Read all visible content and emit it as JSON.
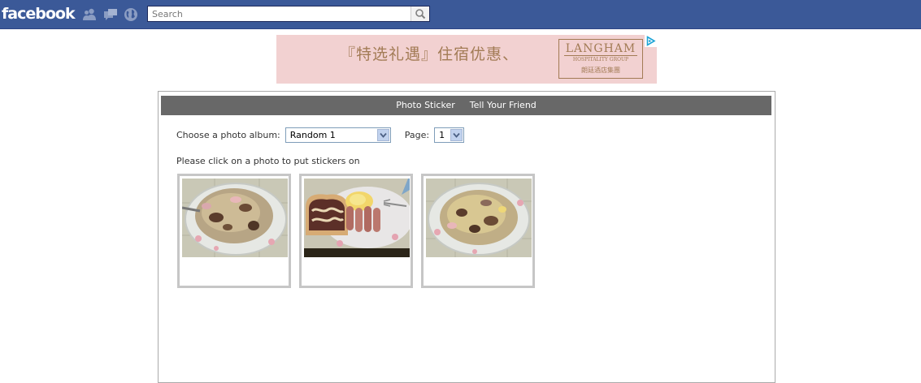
{
  "header": {
    "logo": "facebook",
    "search_placeholder": "Search"
  },
  "ad": {
    "headline": "『特选礼遇』住宿优惠、",
    "brand": "LANGHAM",
    "brand_sub": "HOSPITALITY GROUP",
    "brand_cn": "朗廷酒店集團"
  },
  "app": {
    "nav": [
      "Photo Sticker",
      "Tell Your Friend"
    ],
    "album_label": "Choose a photo album:",
    "album_selected": "Random 1",
    "page_label": "Page:",
    "page_selected": "1",
    "instruction": "Please click on a photo to put stickers on"
  },
  "photos": [
    {
      "subject": "noodle-plate"
    },
    {
      "subject": "toast-sausage-egg-plate"
    },
    {
      "subject": "noodle-plate"
    }
  ],
  "colors": {
    "topbar": "#3b5998",
    "nav": "#686868",
    "ad_bg": "#f2d1d1",
    "ad_text": "#a27b55"
  }
}
